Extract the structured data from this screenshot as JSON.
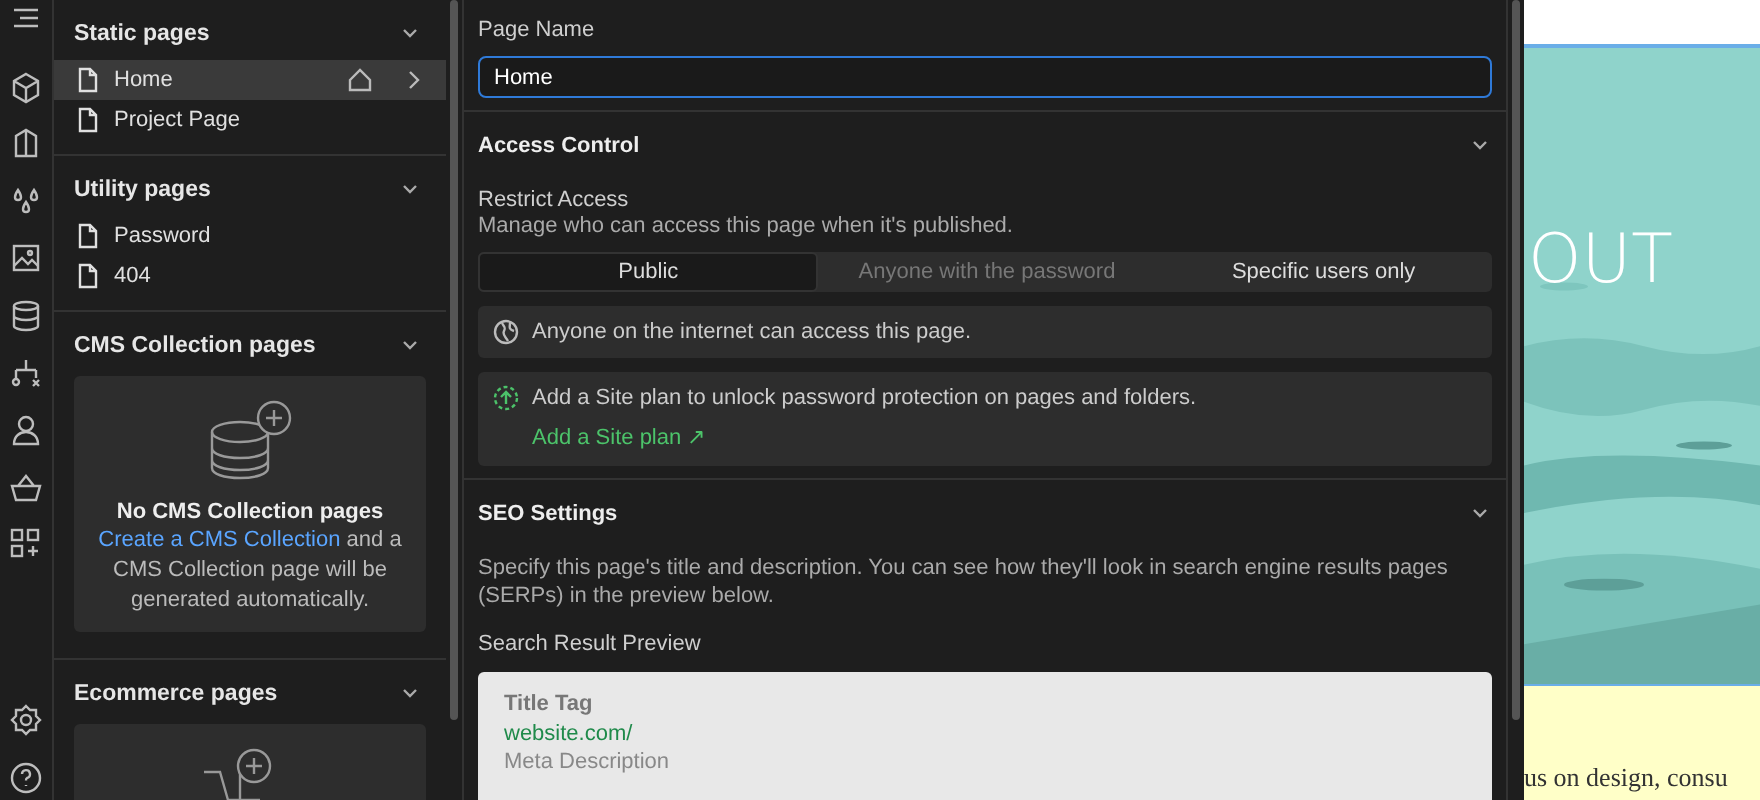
{
  "pages_panel": {
    "sections": [
      {
        "title": "Static pages",
        "items": [
          {
            "label": "Home",
            "selected": true,
            "home": true
          },
          {
            "label": "Project Page",
            "selected": false,
            "home": false
          }
        ]
      },
      {
        "title": "Utility pages",
        "items": [
          {
            "label": "Password",
            "selected": false,
            "home": false
          },
          {
            "label": "404",
            "selected": false,
            "home": false
          }
        ]
      },
      {
        "title": "CMS Collection pages",
        "empty": {
          "kind": "cms",
          "title": "No CMS Collection pages",
          "link": "Create a CMS Collection",
          "text": " and a CMS Collection page will be generated automatically."
        }
      },
      {
        "title": "Ecommerce pages",
        "empty": {
          "kind": "ecommerce"
        }
      }
    ]
  },
  "settings": {
    "page_name": {
      "label": "Page Name",
      "value": "Home"
    },
    "access": {
      "title": "Access Control",
      "restrict_label": "Restrict Access",
      "description": "Manage who can access this page when it's published.",
      "options": [
        {
          "label": "Public",
          "selected": true,
          "disabled": false
        },
        {
          "label": "Anyone with the password",
          "selected": false,
          "disabled": true
        },
        {
          "label": "Specific users only",
          "selected": false,
          "disabled": false
        }
      ],
      "info": "Anyone on the internet can access this page.",
      "upsell": {
        "text": "Add a Site plan to unlock password protection on pages and folders.",
        "link": "Add a Site plan ↗"
      }
    },
    "seo": {
      "title": "SEO Settings",
      "description": "Specify this page's title and description. You can see how they'll look in search engine results pages (SERPs) in the preview below.",
      "preview_label": "Search Result Preview",
      "preview": {
        "title": "Title Tag",
        "url": "website.com/",
        "description": "Meta Description"
      }
    }
  },
  "site_preview": {
    "heading": "OUT",
    "body": "us on design, consu"
  }
}
